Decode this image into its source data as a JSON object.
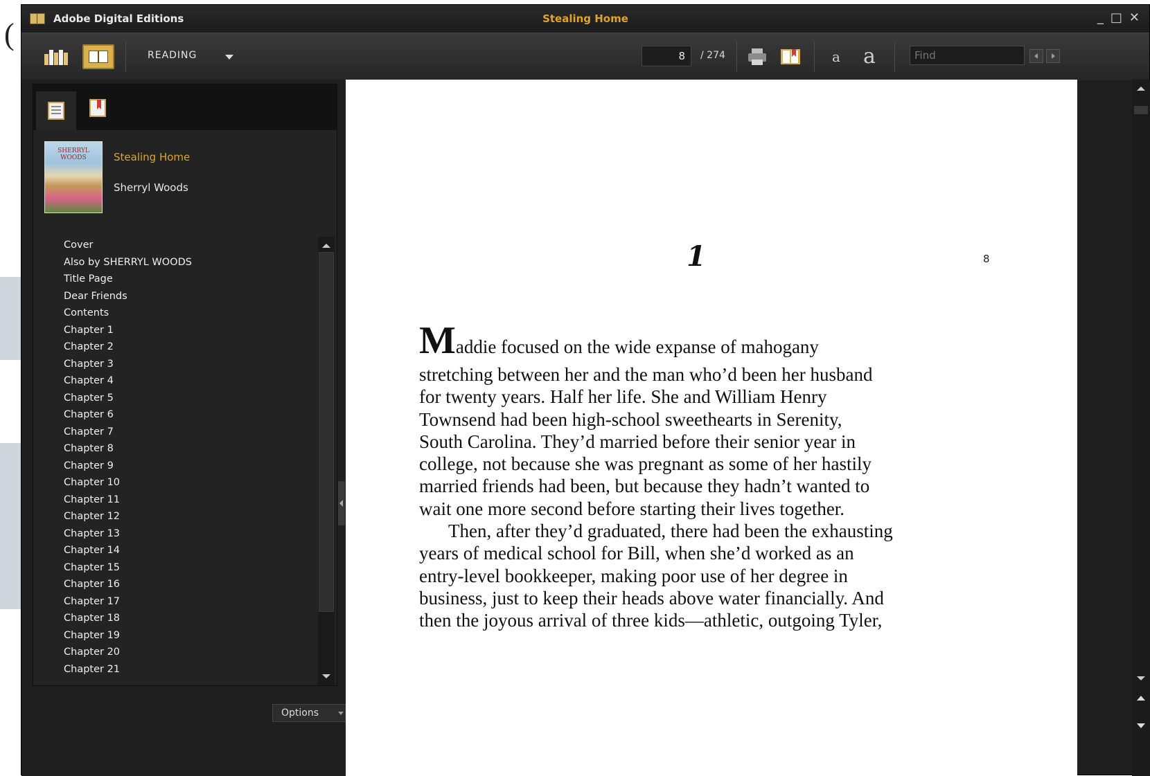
{
  "window": {
    "app_name": "Adobe Digital Editions",
    "document_title": "Stealing Home",
    "controls": {
      "minimize": "_",
      "maximize": "□",
      "close": "✕"
    }
  },
  "toolbar": {
    "view_mode": "READING",
    "current_page": "8",
    "total_pages": "/ 274",
    "find_placeholder": "Find",
    "font_small": "a",
    "font_large": "a",
    "icons": [
      "library-view-icon",
      "reading-view-icon",
      "print-icon",
      "bookmark-icon",
      "decrease-font-icon",
      "increase-font-icon",
      "find-previous-icon",
      "find-next-icon"
    ]
  },
  "sidebar": {
    "tabs": [
      "table-of-contents-tab",
      "bookmarks-tab"
    ],
    "book": {
      "title": "Stealing Home",
      "author": "Sherryl Woods"
    },
    "toc": [
      "Cover",
      "Also by SHERRYL WOODS",
      "Title Page",
      "Dear Friends",
      "Contents",
      "Chapter 1",
      "Chapter 2",
      "Chapter 3",
      "Chapter 4",
      "Chapter 5",
      "Chapter 6",
      "Chapter 7",
      "Chapter 8",
      "Chapter 9",
      "Chapter 10",
      "Chapter 11",
      "Chapter 12",
      "Chapter 13",
      "Chapter 14",
      "Chapter 15",
      "Chapter 16",
      "Chapter 17",
      "Chapter 18",
      "Chapter 19",
      "Chapter 20",
      "Chapter 21"
    ],
    "options_label": "Options"
  },
  "page": {
    "chapter_number": "1",
    "page_number": "8",
    "dropcap": "M",
    "lines": [
      "addie focused on the wide expanse of mahogany",
      "stretching between her and the man who’d been her husband",
      "for twenty years. Half her life. She and William Henry",
      "Townsend had been high-school sweethearts in Serenity,",
      "South Carolina. They’d married before their senior year in",
      "college, not because she was pregnant as some of her hastily",
      "married friends had been, but because they hadn’t wanted to",
      "wait one more second before starting their lives together.",
      "Then, after they’d graduated, there had been the exhausting",
      "years of medical school for Bill, when she’d worked as an",
      "entry-level bookkeeper, making poor use of her degree in",
      "business, just to keep their heads above water financially. And",
      "then the joyous arrival of three kids—athletic, outgoing Tyler,"
    ]
  },
  "colors": {
    "accent": "#e0a42a",
    "chrome": "#1f1f1f",
    "page": "#ffffff"
  }
}
